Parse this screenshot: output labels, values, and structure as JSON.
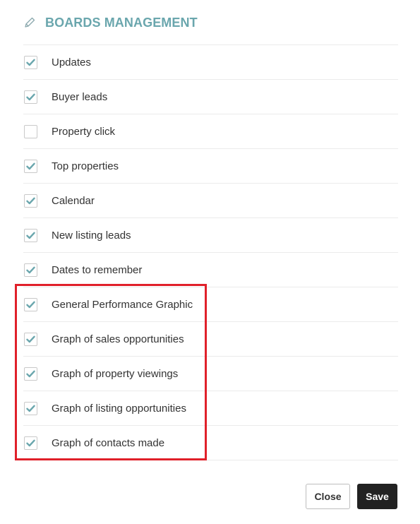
{
  "modal": {
    "title": "BOARDS MANAGEMENT",
    "title_icon": "pencil-icon",
    "accent_color": "#6aa6ad",
    "highlight_color": "#e0202a"
  },
  "items": [
    {
      "label": "Updates",
      "checked": true
    },
    {
      "label": "Buyer leads",
      "checked": true
    },
    {
      "label": "Property click",
      "checked": false
    },
    {
      "label": "Top properties",
      "checked": true
    },
    {
      "label": "Calendar",
      "checked": true
    },
    {
      "label": "New listing leads",
      "checked": true
    },
    {
      "label": "Dates to remember",
      "checked": true
    },
    {
      "label": "General Performance Graphic",
      "checked": true
    },
    {
      "label": "Graph of sales opportunities",
      "checked": true
    },
    {
      "label": "Graph of property viewings",
      "checked": true
    },
    {
      "label": "Graph of listing opportunities",
      "checked": true
    },
    {
      "label": "Graph of contacts made",
      "checked": true
    }
  ],
  "footer": {
    "close_label": "Close",
    "save_label": "Save"
  }
}
